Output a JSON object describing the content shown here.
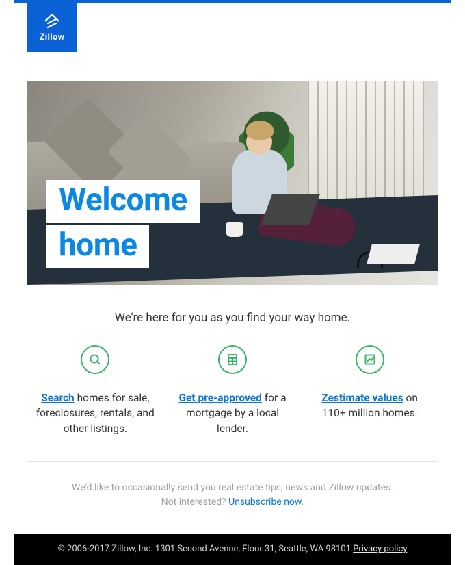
{
  "brand": {
    "name": "Zillow"
  },
  "hero": {
    "headline_line1": "Welcome",
    "headline_line2": "home"
  },
  "subhead": "We're here for you as you find your way home.",
  "features": [
    {
      "icon": "search-icon",
      "lead": "Search",
      "after": " homes for sale, foreclosures, rentals, and other listings."
    },
    {
      "icon": "calculator-icon",
      "lead": "Get pre-approved",
      "after": " for a mortgage by a local lender."
    },
    {
      "icon": "chart-icon",
      "lead": "Zestimate values",
      "after": " on 110+ million homes."
    }
  ],
  "preferences": {
    "line1": "We'd like to occasionally send you real estate tips, news and Zillow updates.",
    "line2_prefix": "Not interested? ",
    "unsubscribe_label": "Unsubscribe now",
    "line2_suffix": "."
  },
  "footer": {
    "copyright": "© 2006-2017 Zillow, Inc.  1301 Second Avenue, Floor 31, Seattle, WA 98101  ",
    "privacy_label": "Privacy policy"
  }
}
